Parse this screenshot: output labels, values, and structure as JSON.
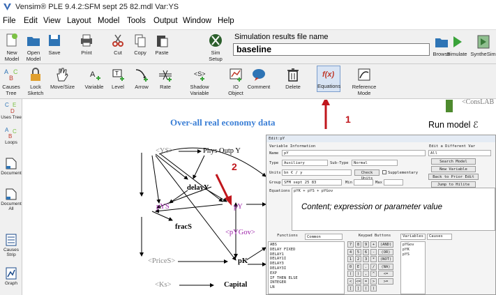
{
  "window": {
    "title": "Vensim® PLE 9.4.2:SFM sept 25 82.mdl Var:YS"
  },
  "menu": [
    "File",
    "Edit",
    "View",
    "Layout",
    "Model",
    "Tools",
    "Output",
    "Window",
    "Help"
  ],
  "toolbar1": {
    "buttons": [
      "New Model",
      "Open Model",
      "Save",
      "Print",
      "Cut",
      "Copy",
      "Paste",
      "Sim Setup"
    ],
    "results_label": "Simulation results file name",
    "results_value": "baseline",
    "browse": "Browse",
    "simulate": "Simulate",
    "synthesim": "SyntheSim"
  },
  "toolbar2": {
    "buttons": [
      "Causes Tree",
      "Lock Sketch",
      "Move/Size",
      "Variable",
      "Level",
      "Arrow",
      "Rate",
      "Shadow Variable",
      "IO Object",
      "Comment",
      "Delete",
      "Equations",
      "Reference Mode"
    ]
  },
  "leftbar": [
    "Uses Tree",
    "Loops",
    "Document",
    "Document All",
    "Causes Strip",
    "Graph"
  ],
  "diagram": {
    "heading": "Over-all real economy data",
    "vars": {
      "ys": "<YS>",
      "phys": "Phys Outp Y",
      "delayy": "delayY",
      "pys": "pYS",
      "py": "pY",
      "fracs": "fracS",
      "pygov": "<pYGov>",
      "prices": "<PriceS>",
      "pk": "pK",
      "ks": "<Ks>",
      "capital": "Capital",
      "conslab": "<ConsLAB"
    }
  },
  "annotations": {
    "n1": "1",
    "n2": "2",
    "run_model": "Run model",
    "content": "Content; expression or parameter value"
  },
  "colors": {
    "red_arrow": "#c0161c",
    "green_arrow": "#4e8a2e",
    "heading_blue": "#3b7fd6",
    "purple_var": "#9b1fa8"
  },
  "equation_dialog": {
    "title": "Edit:pY",
    "info_header": "Variable Information",
    "name_label": "Name",
    "name_value": "pY",
    "type_label": "Type",
    "type_value": "Auxiliary",
    "subtype_label": "Sub-Type",
    "subtype_value": "Normal",
    "units_label": "Units",
    "units_value": "bn € / y",
    "check_units": "Check Units",
    "supplementary": "Supplementary",
    "group_label": "Group",
    "group_value": "SFM sept 25 83",
    "min_label": "Min",
    "max_label": "Max",
    "equations_label": "Equations",
    "equation_value": "pYK + pYS  + pYGov",
    "edit_different": "Edit a Different Var",
    "edit_scope": "All",
    "search_model": "Search Model",
    "new_variable": "New Variable",
    "back_prior": "Back to Prior Edit",
    "jump_hilite": "Jump to Hilite",
    "functions_tab": "Functions",
    "functions_filter": "Common",
    "keypad_tab": "Keypad Buttons",
    "variables_tab": "Variables",
    "causes_tab": "Causes",
    "functions": [
      "ABS",
      "DELAY FIXED",
      "DELAY1",
      "DELAY1I",
      "DELAY3",
      "DELAY3I",
      "EXP",
      "IF THEN ELSE",
      "INTEGER",
      "LN"
    ],
    "keypad": [
      [
        "7",
        "8",
        "9",
        "+",
        "(AND)"
      ],
      [
        "4",
        "5",
        "6",
        "-",
        "(OR)"
      ],
      [
        "1",
        "2",
        "3",
        "*",
        "(NOT)"
      ],
      [
        "0",
        "E",
        ".",
        "/",
        "(NA)"
      ],
      [
        "(",
        ")",
        ",",
        "^",
        "<="
      ],
      [
        "<",
        "<=",
        "=",
        ">",
        ">="
      ],
      [
        "[",
        "]",
        "(",
        ")",
        ""
      ]
    ],
    "causes": [
      "pYGov",
      "pYK",
      "pYS"
    ]
  }
}
